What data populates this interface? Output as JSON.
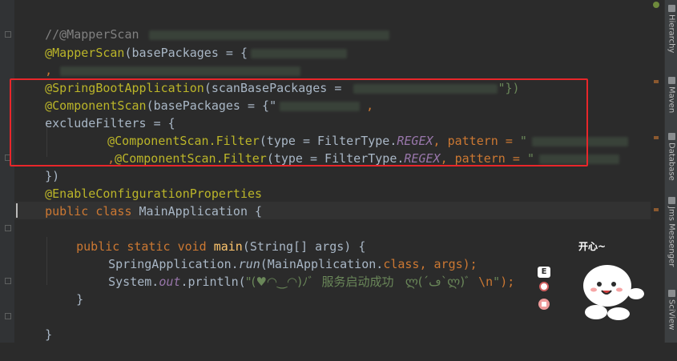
{
  "editor": {
    "lines": {
      "comment_mapperscan": "//@MapperScan",
      "mapperscan_annotation": "@MapperScan",
      "mapperscan_args": "(basePackages = {",
      "comma_line": ",",
      "springboot_annotation": "@SpringBootApplication",
      "springboot_args": "(scanBasePackages = ",
      "springboot_end": "\"})",
      "componentscan_annotation": "@ComponentScan",
      "componentscan_args": "(basePackages = {\"",
      "componentscan_comma": ",",
      "exclude_filters": "excludeFilters = {",
      "filter1_annotation": "@ComponentScan.Filter",
      "filter1_type": "(type = FilterType.",
      "filter1_regex": "REGEX",
      "filter1_pattern": ", pattern = ",
      "filter1_quote": "\"",
      "filter2_prefix": ",",
      "filter2_annotation": "@ComponentScan.Filter",
      "filter2_type": "(type = FilterType.",
      "filter2_regex": "REGEX",
      "filter2_pattern": ", pattern = ",
      "filter2_quote": "\"",
      "close_braces": "})",
      "enable_config_annotation": "@EnableConfigurationProperties",
      "public_kw": "public",
      "class_kw": "class",
      "class_name": "MainApplication {",
      "method_public": "public",
      "method_static": "static",
      "method_void": "void",
      "method_name": "main",
      "method_args": "(String[] args) {",
      "spring_run_prefix": "SpringApplication.",
      "spring_run_method": "run",
      "spring_run_args": "(MainApplication.",
      "spring_run_class_kw": "class",
      "spring_run_end": ", args);",
      "println_prefix": "System.",
      "println_out": "out",
      "println_call": ".println(",
      "println_string_start": "\"(♥◠‿◠)ﾉﾞ  服务启动成功   ლ(´ڡ`ლ)ﾞ  ",
      "println_escape": "\\n",
      "println_string_end": "\"",
      "println_end": ");",
      "method_close": "}",
      "class_close": "}"
    }
  },
  "sticker": {
    "caption": "开心~",
    "badge_e": "E"
  },
  "tool_window": {
    "tabs": [
      "Hierarchy",
      "Maven",
      "Database",
      "Jms Messenger",
      "SciView"
    ]
  },
  "colors": {
    "background": "#2b2b2b",
    "annotation": "#bbb529",
    "keyword": "#cc7832",
    "string": "#6a8759",
    "comment": "#808080",
    "static_field": "#9876aa",
    "method_decl": "#ffc66d",
    "highlight_box": "#e8262a"
  }
}
